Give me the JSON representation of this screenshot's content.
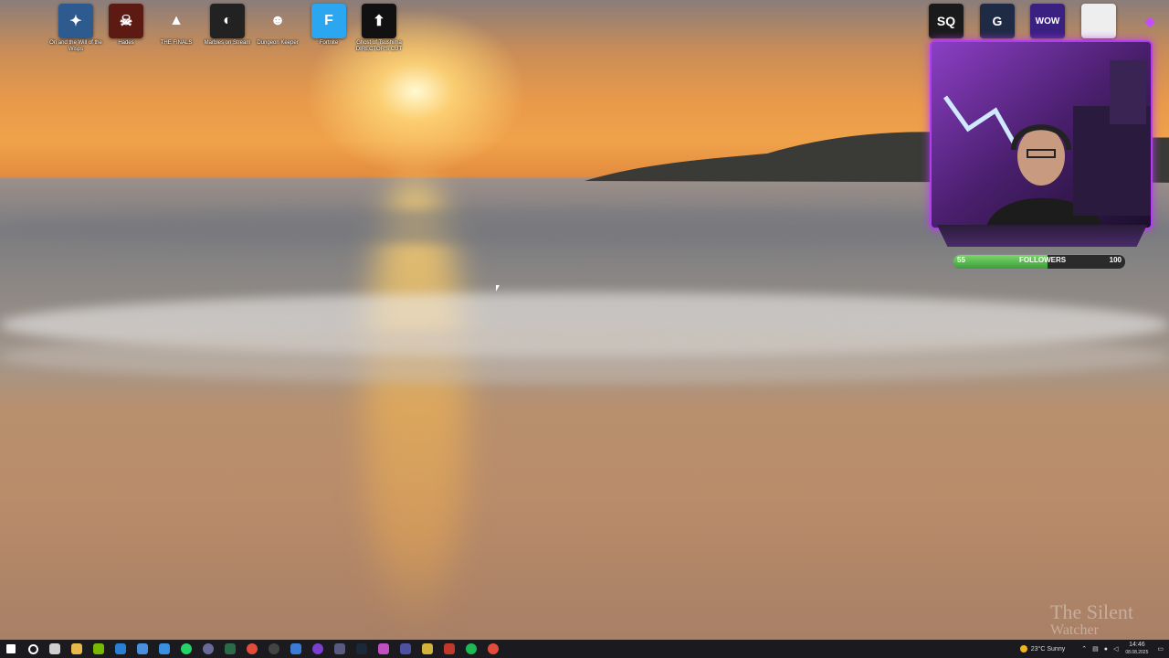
{
  "desktop_icons": [
    {
      "label": "Ori and the Will of the Wisps",
      "icon": "ori-icon",
      "color": "#2d5b8f",
      "glyph": "✦"
    },
    {
      "label": "Hades",
      "icon": "hades-icon",
      "color": "#5c1a12",
      "glyph": "☠"
    },
    {
      "label": "THE FINALS",
      "icon": "the-finals-icon",
      "color": "#00000000",
      "glyph": "▲"
    },
    {
      "label": "Marbles on Stream",
      "icon": "marbles-icon",
      "color": "#222222",
      "glyph": "◐"
    },
    {
      "label": "Dungeon Keeper",
      "icon": "dungeon-keeper-icon",
      "color": "#00000000",
      "glyph": "☻"
    },
    {
      "label": "Fortnite",
      "icon": "fortnite-icon",
      "color": "#2aa7f0",
      "glyph": "F"
    },
    {
      "label": "Ghost of Tsushima DIRECTOR'S CUT",
      "icon": "ghost-of-tsushima-icon",
      "color": "#111111",
      "glyph": "⬆"
    }
  ],
  "right_icons": [
    {
      "icon": "sq-app-icon",
      "glyph": "SQ",
      "color": "#1a1a1a"
    },
    {
      "icon": "g-app-icon",
      "glyph": "G",
      "color": "#1f2a44"
    },
    {
      "icon": "wow-app-icon",
      "glyph": "WOW",
      "color": "#3a2080"
    },
    {
      "icon": "white-app-icon",
      "glyph": "",
      "color": "#eeeeee"
    },
    {
      "icon": "diamond-app-icon",
      "glyph": "◆",
      "color": "#00000000"
    }
  ],
  "followers_bar": {
    "start": "55",
    "label": "FOLLOWERS",
    "end": "100",
    "progress": 0.55
  },
  "taskbar": {
    "items": [
      "start-icon",
      "search-icon",
      "task-view-icon",
      "file-explorer-icon",
      "nvidia-icon",
      "mail-icon",
      "notes-icon",
      "store-icon",
      "whatsapp-icon",
      "app-icon-1",
      "app-icon-2",
      "chrome-icon",
      "obs-icon",
      "app-icon-3",
      "app-icon-4",
      "app-icon-5",
      "steam-icon",
      "app-icon-6",
      "app-icon-7",
      "app-icon-8",
      "app-icon-9",
      "spotify-icon",
      "chrome-icon-2"
    ],
    "weather": "23°C  Sunny",
    "time": "14:46",
    "date": "08.08.2025"
  },
  "watermark": {
    "line1": "The Silent",
    "line2": "Watcher"
  }
}
